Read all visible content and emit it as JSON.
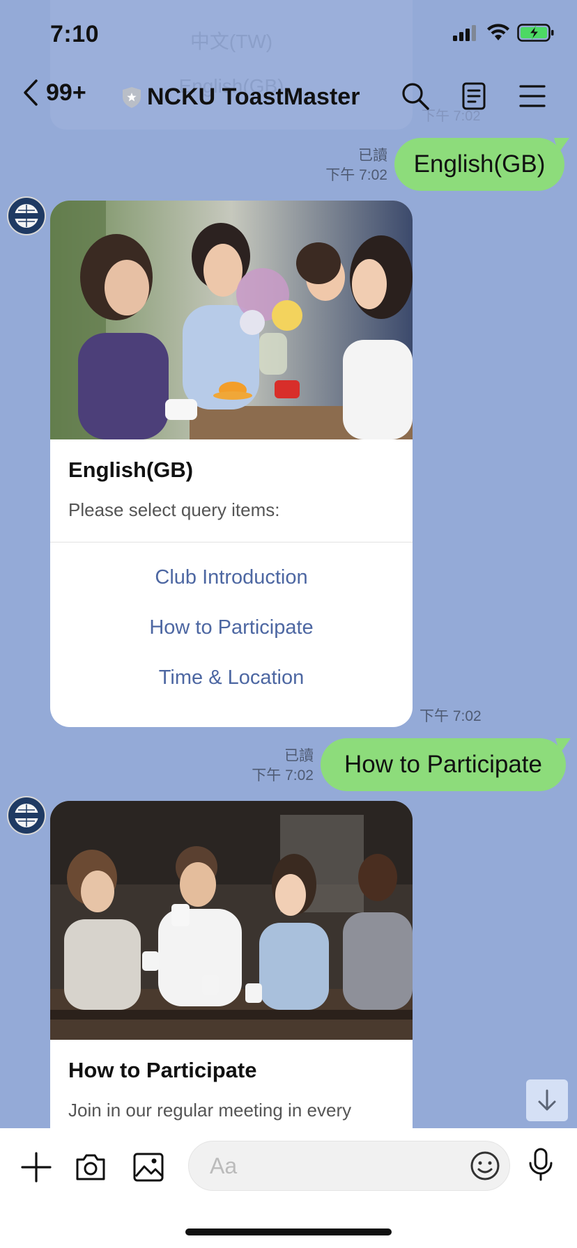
{
  "status_bar": {
    "time": "7:10",
    "battery_color": "#4cd964"
  },
  "ghost_menu": {
    "item_1": "中文(TW)",
    "item_2": "English(GB)",
    "time": "下午 7:02"
  },
  "header": {
    "back_count": "99+",
    "title": "NCKU ToastMaster"
  },
  "messages": [
    {
      "type": "outgoing",
      "read": "已讀",
      "time": "下午 7:02",
      "text": "English(GB)"
    },
    {
      "type": "incoming_card",
      "title": "English(GB)",
      "subtitle": "Please select query items:",
      "actions": [
        "Club Introduction",
        "How to Participate",
        "Time & Location"
      ],
      "time": "下午 7:02"
    },
    {
      "type": "outgoing",
      "read": "已讀",
      "time": "下午 7:02",
      "text": "How to Participate"
    },
    {
      "type": "incoming_card",
      "title": "How to Participate",
      "subtitle": "Join in our regular meeting in every"
    }
  ],
  "input_bar": {
    "placeholder": "Aa"
  },
  "colors": {
    "background": "#94aad7",
    "outgoing_bubble": "#8ddc7b",
    "action_link": "#4d67a2"
  }
}
